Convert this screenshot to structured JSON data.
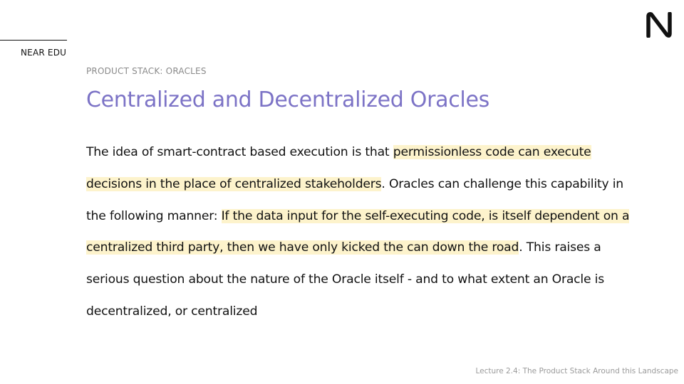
{
  "brand": "NEAR EDU",
  "section_label": "PRODUCT STACK: ORACLES",
  "title": "Centralized and Decentralized Oracles",
  "paragraph": {
    "seg1": "The idea of smart-contract based execution is that ",
    "hl1": "permissionless code can execute decisions in the place of centralized stakeholders",
    "seg2": ". Oracles can challenge this capability in the following manner: ",
    "hl2": "If the data input for the self-executing code, is itself dependent on a centralized third party, then we have only kicked the can down the road",
    "seg3": ". This raises a serious question about the nature of the Oracle itself - and to what extent an Oracle is decentralized, or centralized"
  },
  "footer": "Lecture 2.4: The Product Stack Around this Landscape",
  "colors": {
    "title": "#7c73c6",
    "highlight": "#fdf3cc"
  },
  "icons": {
    "logo": "near-logo-icon"
  }
}
